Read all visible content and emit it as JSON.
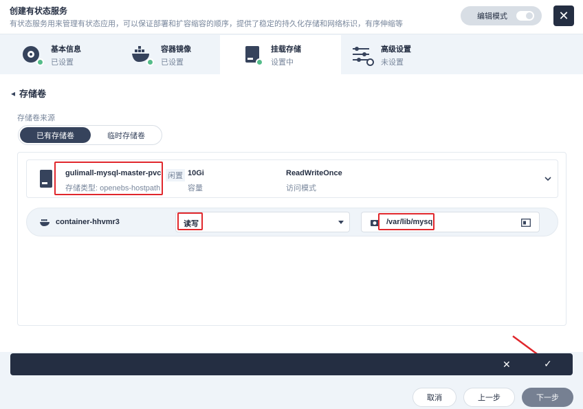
{
  "header": {
    "title": "创建有状态服务",
    "description": "有状态服务用来管理有状态应用，可以保证部署和扩容缩容的顺序，提供了稳定的持久化存储和网络标识，有序伸缩等",
    "edit_mode_label": "编辑模式",
    "close_glyph": "✕"
  },
  "steps": [
    {
      "name": "基本信息",
      "status": "已设置"
    },
    {
      "name": "容器镜像",
      "status": "已设置"
    },
    {
      "name": "挂载存储",
      "status": "设置中"
    },
    {
      "name": "高级设置",
      "status": "未设置"
    }
  ],
  "section": {
    "back_glyph": "◂",
    "title": "存储卷",
    "source_label": "存储卷来源",
    "source_options": [
      "已有存储卷",
      "临时存储卷"
    ]
  },
  "volume": {
    "name": "gulimall-mysql-master-pvc",
    "type_line": "存储类型: openebs-hostpath",
    "badge": "闲置",
    "capacity": "10Gi",
    "capacity_label": "容量",
    "access_mode": "ReadWriteOnce",
    "access_mode_label": "访问模式"
  },
  "mount": {
    "container": "container-hhvmr3",
    "mode": "读写",
    "path": "/var/lib/mysql"
  },
  "confirm_bar": {
    "cancel_glyph": "✕",
    "ok_glyph": "✓"
  },
  "footer": {
    "cancel": "取消",
    "prev": "上一步",
    "next": "下一步"
  },
  "colors": {
    "primary": "#36435c",
    "dark": "#242e42",
    "success": "#55bc8a",
    "highlight": "#e0262b"
  }
}
